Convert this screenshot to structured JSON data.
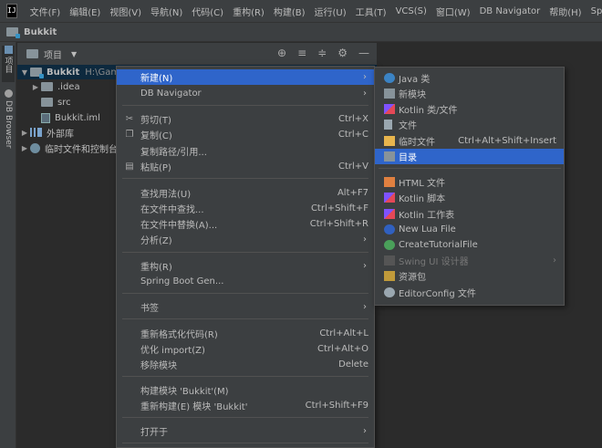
{
  "menubar": {
    "logo": "IJ",
    "items": [
      "文件(F)",
      "编辑(E)",
      "视图(V)",
      "导航(N)",
      "代码(C)",
      "重构(R)",
      "构建(B)",
      "运行(U)",
      "工具(T)",
      "VCS(S)",
      "窗口(W)",
      "DB Navigator",
      "帮助(H)",
      "Sprin"
    ]
  },
  "navbar": {
    "project": "Bukkit"
  },
  "leftstrip": {
    "project_tab": "项目",
    "db_tab": "DB Browser"
  },
  "panel": {
    "title": "项目"
  },
  "tree": {
    "root_name": "Bukkit",
    "root_path": "H:\\Gam",
    "idea": ".idea",
    "src": "src",
    "iml": "Bukkit.iml",
    "libs": "外部库",
    "scratches": "临时文件和控制台"
  },
  "context_menu": {
    "new": "新建(N)",
    "db_navigator": "DB Navigator",
    "cut": "剪切(T)",
    "cut_sc": "Ctrl+X",
    "copy": "复制(C)",
    "copy_sc": "Ctrl+C",
    "copy_path": "复制路径/引用...",
    "paste": "粘贴(P)",
    "paste_sc": "Ctrl+V",
    "find_usages": "查找用法(U)",
    "find_usages_sc": "Alt+F7",
    "find_in_files": "在文件中查找...",
    "find_in_files_sc": "Ctrl+Shift+F",
    "replace_in_files": "在文件中替换(A)...",
    "replace_in_files_sc": "Ctrl+Shift+R",
    "analyze": "分析(Z)",
    "refactor": "重构(R)",
    "spring_boot": "Spring Boot Gen...",
    "bookmarks": "书签",
    "reformat": "重新格式化代码(R)",
    "reformat_sc": "Ctrl+Alt+L",
    "optimize_imports": "优化 import(Z)",
    "optimize_imports_sc": "Ctrl+Alt+O",
    "remove_module": "移除模块",
    "remove_module_sc": "Delete",
    "build_module": "构建模块 'Bukkit'(M)",
    "rebuild_module": "重新构建(E) 模块 'Bukkit'",
    "rebuild_module_sc": "Ctrl+Shift+F9",
    "open_in": "打开于"
  },
  "submenu": {
    "java_class": "Java 类",
    "new_module": "新模块",
    "kotlin_class": "Kotlin 类/文件",
    "file": "文件",
    "scratch_file": "临时文件",
    "scratch_file_sc": "Ctrl+Alt+Shift+Insert",
    "directory": "目录",
    "html_file": "HTML 文件",
    "kotlin_script": "Kotlin 脚本",
    "kotlin_worksheet": "Kotlin 工作表",
    "lua_file": "New Lua File",
    "tutorial_file": "CreateTutorialFile",
    "swing_designer": "Swing UI 设计器",
    "resource_bundle": "资源包",
    "editorconfig": "EditorConfig 文件"
  },
  "colors": {
    "highlight": "#2f65ca",
    "background": "#2b2b2b",
    "panel": "#3c3f41"
  }
}
